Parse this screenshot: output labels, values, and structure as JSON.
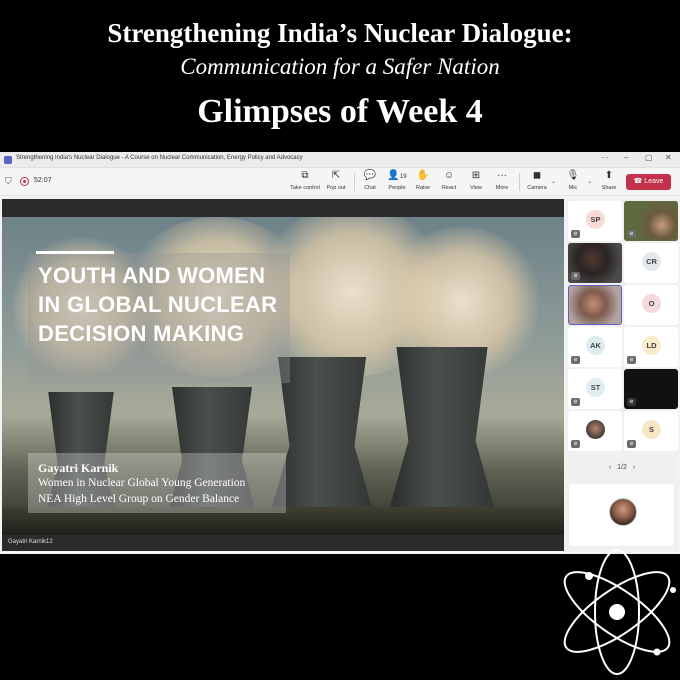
{
  "poster": {
    "title_line1": "Strengthening India’s Nuclear Dialogue:",
    "title_line2": "Communication for a Safer Nation",
    "title_line3": "Glimpses of Week 4"
  },
  "window": {
    "title": "Strengthening India's Nuclear Dialogue - A Course on Nuclear Communication, Energy Policy and Advocacy",
    "more_glyph": "···",
    "minimize_glyph": "–",
    "maximize_glyph": "▢",
    "close_glyph": "✕"
  },
  "toolbar": {
    "timer": "52:07",
    "buttons": [
      {
        "label": "Take control",
        "icon": "take-control-icon",
        "glyph": "⧉"
      },
      {
        "label": "Pop out",
        "icon": "pop-out-icon",
        "glyph": "⇱"
      },
      {
        "label": "Chat",
        "icon": "chat-icon",
        "glyph": "💬"
      },
      {
        "label": "People",
        "icon": "people-icon",
        "glyph": "👤",
        "badge": "19"
      },
      {
        "label": "Raise",
        "icon": "raise-hand-icon",
        "glyph": "✋"
      },
      {
        "label": "React",
        "icon": "react-icon",
        "glyph": "☺"
      },
      {
        "label": "View",
        "icon": "view-icon",
        "glyph": "⊞"
      },
      {
        "label": "More",
        "icon": "more-icon",
        "glyph": "···"
      },
      {
        "label": "Camera",
        "icon": "camera-off-icon",
        "glyph": "◼"
      },
      {
        "label": "Mic",
        "icon": "mic-off-icon",
        "glyph": "🎙"
      },
      {
        "label": "Share",
        "icon": "share-icon",
        "glyph": "⬆"
      }
    ],
    "chevron": "⌄",
    "leave_label": "Leave",
    "leave_icon": "☎"
  },
  "slide": {
    "headline": "YOUTH AND WOMEN IN GLOBAL NUCLEAR DECISION MAKING",
    "speaker_name": "Gayatri Karnik",
    "speaker_line1": "Women in Nuclear Global Young Generation",
    "speaker_line2": "NEA High Level Group on Gender Balance"
  },
  "presenter_label": "Gayatri Karnik12",
  "participants": [
    {
      "initials": "SP",
      "color": "#f6dcd4"
    },
    {
      "initials": "",
      "color": "#5d6b3f",
      "video": true
    },
    {
      "initials": "",
      "color": "#3b3533",
      "video": true
    },
    {
      "initials": "CR",
      "color": "#e3e8ec"
    },
    {
      "initials": "",
      "color": "#a58b84",
      "video": true
    },
    {
      "initials": "O",
      "color": "#f5d9de"
    },
    {
      "initials": "AK",
      "color": "#dcecef"
    },
    {
      "initials": "LD",
      "color": "#f7ebc9"
    },
    {
      "initials": "ST",
      "color": "#e1eef1"
    },
    {
      "initials": "",
      "color": "#000000",
      "video": true
    },
    {
      "initials": "",
      "color": "#5a4a44",
      "video": true
    },
    {
      "initials": "S",
      "color": "#f7e6c3"
    }
  ],
  "pager": {
    "text": "1/2",
    "prev": "‹",
    "next": "›"
  },
  "colors": {
    "accent": "#5b5fc7",
    "leave": "#c4314b"
  }
}
